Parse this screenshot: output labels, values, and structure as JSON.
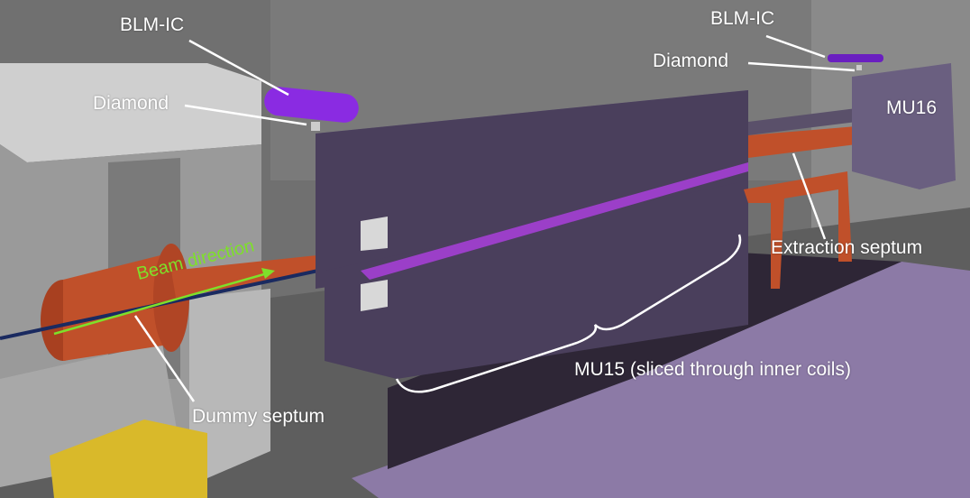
{
  "labels": {
    "blm_ic_left": "BLM-IC",
    "diamond_left": "Diamond",
    "blm_ic_right": "BLM-IC",
    "diamond_right": "Diamond",
    "mu16": "MU16",
    "extraction_septum": "Extraction septum",
    "beam_direction": "Beam direction",
    "mu15": "MU15 (sliced through inner coils)",
    "dummy_septum": "Dummy septum"
  },
  "colors": {
    "magnet": "#4a3f5c",
    "septum": "#c0502a",
    "blm_ic": "#8a2be2",
    "beam_arrow": "#7ee02a",
    "floor_shadow_highlight": "#8c7aa6",
    "yellow_box": "#d9b92a"
  }
}
